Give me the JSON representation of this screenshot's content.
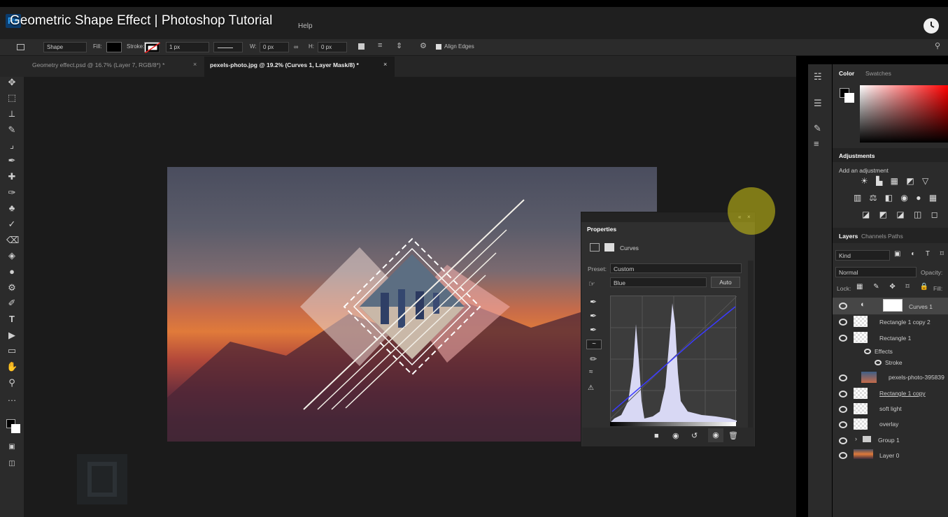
{
  "video": {
    "title": "Geometric Shape Effect | Photoshop Tutorial"
  },
  "menu": {
    "help": "Help"
  },
  "options": {
    "mode": "Shape",
    "fill_label": "Fill:",
    "stroke_label": "Stroke:",
    "stroke_width": "1 px",
    "w_label": "W:",
    "w_value": "0 px",
    "h_label": "H:",
    "h_value": "0 px",
    "align_edges": "Align Edges"
  },
  "tabs": [
    {
      "label": "Geometry effect.psd @ 16.7% (Layer 7, RGB/8*) *",
      "active": false
    },
    {
      "label": "pexels-photo.jpg @ 19.2% (Curves 1, Layer Mask/8) *",
      "active": true
    }
  ],
  "properties": {
    "tab": "Properties",
    "adjustment": "Curves",
    "preset_label": "Preset:",
    "preset_value": "Custom",
    "channel": "Blue",
    "auto_button": "Auto"
  },
  "color_panel": {
    "tabs": [
      "Color",
      "Swatches"
    ]
  },
  "adjustments": {
    "title": "Adjustments",
    "add": "Add an adjustment"
  },
  "layers_panel": {
    "tabs": [
      "Layers",
      "Channels",
      "Paths"
    ],
    "kind": "Kind",
    "blend": "Normal",
    "opacity_label": "Opacity:",
    "lock_label": "Lock:",
    "fill_label": "Fill:",
    "layers": [
      {
        "name": "Curves 1",
        "type": "adjustment"
      },
      {
        "name": "Rectangle 1 copy 2",
        "type": "shape"
      },
      {
        "name": "Rectangle 1",
        "type": "shape"
      },
      {
        "name": "Effects",
        "type": "effects"
      },
      {
        "name": "Stroke",
        "type": "effect"
      },
      {
        "name": "pexels-photo-395839",
        "type": "image"
      },
      {
        "name": "Rectangle 1 copy",
        "type": "shape"
      },
      {
        "name": "soft light",
        "type": "shape"
      },
      {
        "name": "overlay",
        "type": "shape"
      },
      {
        "name": "Group 1",
        "type": "group"
      },
      {
        "name": "Layer 0",
        "type": "image"
      }
    ]
  },
  "colors": {
    "accent": "#31a8ff",
    "panel": "#2b2b2b",
    "canvas": "#1b1b1b",
    "curve": "#3a3aff"
  }
}
